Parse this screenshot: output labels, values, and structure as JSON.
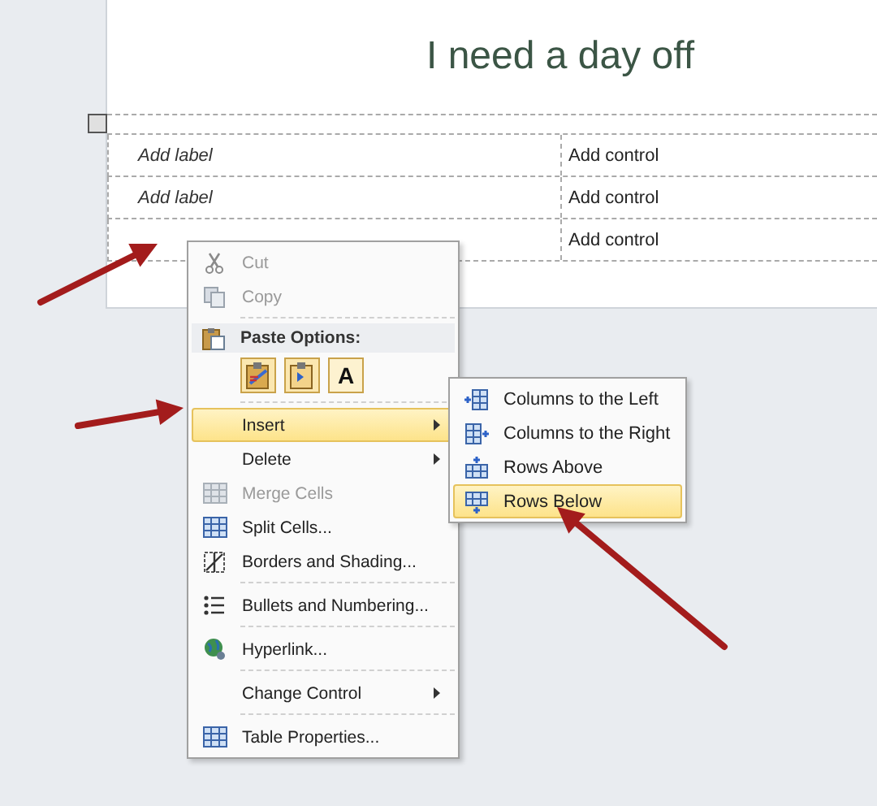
{
  "form": {
    "title": "I need a day off",
    "rows": [
      {
        "label": "Add label",
        "control": "Add control"
      },
      {
        "label": "Add label",
        "control": "Add control"
      },
      {
        "label": "",
        "control": "Add control"
      }
    ]
  },
  "context_menu": {
    "groups": [
      [
        {
          "label": "Cut",
          "disabled": true,
          "selected": false,
          "submenu": false
        },
        {
          "label": "Copy",
          "disabled": true,
          "selected": false,
          "submenu": false
        }
      ],
      {
        "kind": "paste",
        "label": "Paste Options:",
        "buttons": [
          {
            "kind": "keep-formatting"
          },
          {
            "kind": "merge"
          },
          {
            "kind": "text-only",
            "text": "A"
          }
        ]
      },
      [
        {
          "label": "Insert",
          "disabled": false,
          "selected": true,
          "submenu": true
        },
        {
          "label": "Delete",
          "disabled": false,
          "selected": false,
          "submenu": true
        },
        {
          "label": "Merge Cells",
          "disabled": true,
          "selected": false,
          "submenu": false
        },
        {
          "label": "Split Cells...",
          "disabled": false,
          "selected": false,
          "submenu": false
        },
        {
          "label": "Borders and Shading...",
          "disabled": false,
          "selected": false,
          "submenu": false
        }
      ],
      [
        {
          "label": "Bullets and Numbering...",
          "disabled": false,
          "selected": false,
          "submenu": false
        }
      ],
      [
        {
          "label": "Hyperlink...",
          "disabled": false,
          "selected": false,
          "submenu": false
        }
      ],
      [
        {
          "label": "Change Control",
          "disabled": false,
          "selected": false,
          "submenu": true
        }
      ],
      [
        {
          "label": "Table Properties...",
          "disabled": false,
          "selected": false,
          "submenu": false
        }
      ]
    ]
  },
  "submenu": {
    "items": [
      {
        "label": "Columns to the Left",
        "selected": false
      },
      {
        "label": "Columns to the Right",
        "selected": false
      },
      {
        "label": "Rows Above",
        "selected": false
      },
      {
        "label": "Rows Below",
        "selected": true
      }
    ]
  }
}
